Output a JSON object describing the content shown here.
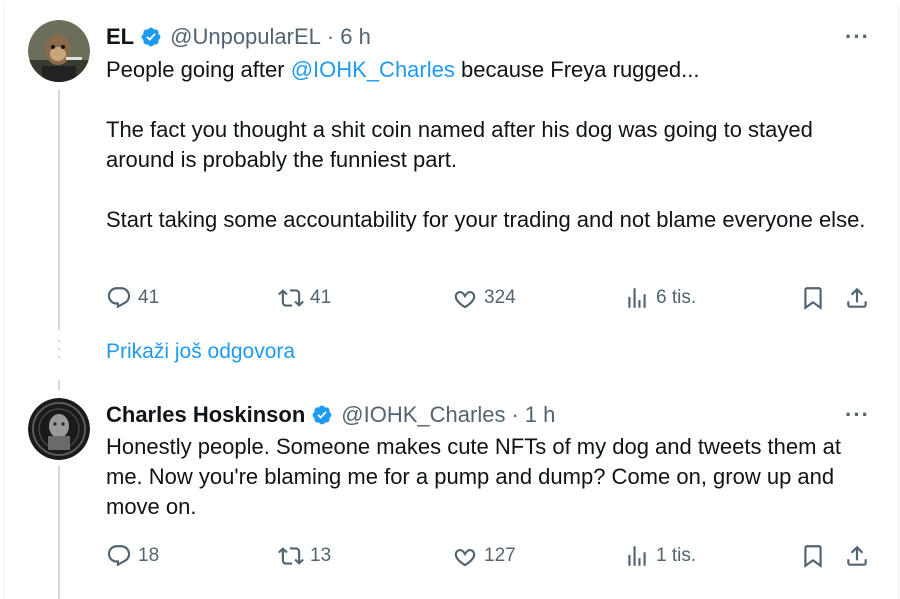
{
  "tweets": [
    {
      "name": "EL",
      "handle": "@UnpopularEL",
      "separator": "·",
      "time": "6 h",
      "more": "···",
      "text_prefix": "People going after ",
      "mention": "@IOHK_Charles",
      "text_suffix": " because Freya rugged...",
      "paragraph2": "The fact you thought a shit coin named after his dog was going to stayed around is probably the funniest part.",
      "paragraph3": "Start taking some accountability for your trading and not blame everyone else.",
      "replies": "41",
      "reposts": "41",
      "likes": "324",
      "views": "6 tis."
    },
    {
      "name": "Charles Hoskinson",
      "handle": "@IOHK_Charles",
      "separator": "·",
      "time": "1 h",
      "more": "···",
      "text": "Honestly people. Someone makes cute NFTs of my dog and tweets them at me. Now you're blaming me for a pump and dump? Come on, grow up and move on.",
      "replies": "18",
      "reposts": "13",
      "likes": "127",
      "views": "1 tis."
    }
  ],
  "show_more_replies": "Prikaži još odgovora",
  "colors": {
    "accent": "#1d9bf0",
    "text": "#0f1419",
    "muted": "#536471",
    "thread_line": "#cfd9de"
  }
}
